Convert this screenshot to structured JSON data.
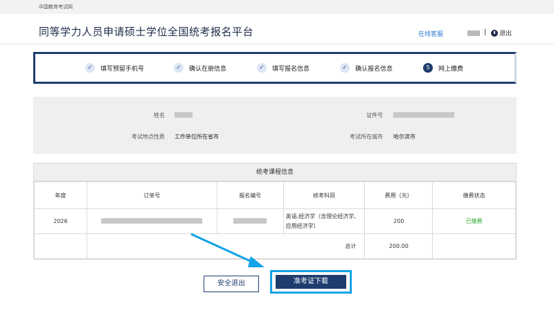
{
  "site": {
    "brand": "中国教育考试网"
  },
  "header": {
    "title": "同等学力人员申请硕士学位全国统考报名平台",
    "service_label": "在线客服",
    "separator": "|",
    "logout_label": "退出"
  },
  "steps": [
    {
      "label": "填写预留手机号",
      "icon": "check-icon"
    },
    {
      "label": "确认在册信息",
      "icon": "check-icon"
    },
    {
      "label": "填写报名信息",
      "icon": "check-icon"
    },
    {
      "label": "确认报名信息",
      "icon": "check-icon"
    },
    {
      "label": "网上缴费",
      "number": "5"
    }
  ],
  "info": {
    "name_label": "姓名",
    "id_label": "证件号",
    "exam_location_type_label": "考试地点性质",
    "exam_location_type_value": "工作单位所在省市",
    "exam_city_label": "考试所在城市",
    "exam_city_value": "哈尔滨市"
  },
  "course": {
    "caption": "统考课程信息",
    "headers": [
      "年度",
      "订单号",
      "报名编号",
      "统考科目",
      "费用（元）",
      "缴费状态"
    ],
    "row": {
      "year": "2026",
      "subject": "英语,经济学（含理论经济学、应用经济学）",
      "fee": "200",
      "status": "已缴费"
    },
    "total_label": "总计",
    "total_value": "200.00"
  },
  "actions": {
    "exit_label": "安全退出",
    "download_label": "准考证下载"
  },
  "colors": {
    "primary": "#1e3d6e",
    "link": "#2f7bd1",
    "paid": "#2aa52a",
    "highlight": "#12a2e8"
  }
}
